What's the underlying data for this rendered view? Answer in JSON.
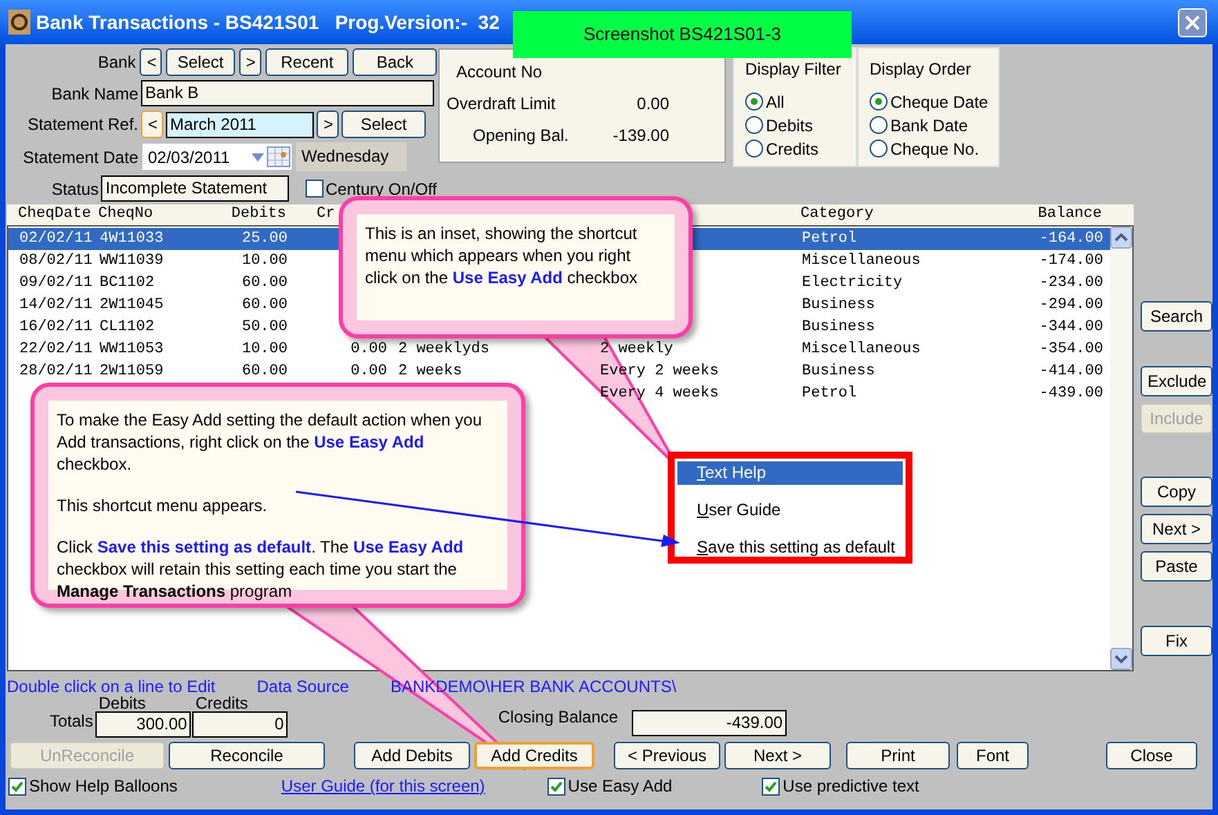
{
  "window": {
    "title": "Bank Transactions - BS421S01   Prog.Version:-  32"
  },
  "banner": {
    "text": "Screenshot BS421S01-3"
  },
  "bank": {
    "label": "Bank",
    "buttons": [
      "<",
      "Select",
      ">",
      "Recent",
      "Back"
    ]
  },
  "bank_name": {
    "label": "Bank Name",
    "value": "Bank B"
  },
  "statement_ref": {
    "label": "Statement Ref.",
    "prev": "<",
    "value": "March 2011",
    "next": ">",
    "select": "Select"
  },
  "statement_date": {
    "label": "Statement Date",
    "value": "02/03/2011",
    "day": "Wednesday"
  },
  "status": {
    "label": "Status",
    "value": "Incomplete Statement"
  },
  "century": {
    "label": "Century On/Off",
    "checked": false
  },
  "account": [
    {
      "label": "Account No"
    },
    {
      "label": "Overdraft Limit",
      "value": "0.00"
    },
    {
      "label": "Opening Bal.",
      "value": "-139.00"
    }
  ],
  "display_filter": {
    "title": "Display Filter",
    "options": [
      {
        "label": "All",
        "selected": true
      },
      {
        "label": "Debits",
        "selected": false
      },
      {
        "label": "Credits",
        "selected": false
      }
    ]
  },
  "display_order": {
    "title": "Display Order",
    "options": [
      {
        "label": "Cheque Date",
        "selected": true
      },
      {
        "label": "Bank Date",
        "selected": false
      },
      {
        "label": "Cheque No.",
        "selected": false
      }
    ]
  },
  "table": {
    "columns": {
      "cheq_date": "CheqDate",
      "cheq_no": "CheqNo",
      "debits": "Debits",
      "credits": "Cr",
      "category": "Category",
      "balance": "Balance"
    },
    "rows": [
      {
        "cheq_date": "02/02/11",
        "cheq_no": "4W11033",
        "debits": "25.00",
        "category": "Petrol",
        "balance": "-164.00",
        "selected": true
      },
      {
        "cheq_date": "08/02/11",
        "cheq_no": "WW11039",
        "debits": "10.00",
        "category": "Miscellaneous",
        "balance": "-174.00",
        "selected": false
      },
      {
        "cheq_date": "09/02/11",
        "cheq_no": "BC1102",
        "debits": "60.00",
        "category": "Electricity",
        "balance": "-234.00",
        "selected": false
      },
      {
        "cheq_date": "14/02/11",
        "cheq_no": "2W11045",
        "debits": "60.00",
        "category": "Business",
        "balance": "-294.00",
        "selected": false
      },
      {
        "cheq_date": "16/02/11",
        "cheq_no": "CL1102",
        "debits": "50.00",
        "category": "Business",
        "balance": "-344.00",
        "selected": false
      },
      {
        "cheq_date": "22/02/11",
        "cheq_no": "WW11053",
        "debits": "10.00",
        "credits": "0.00",
        "column_5": "2 weeklyds",
        "column_6": "2 weekly",
        "category": "Miscellaneous",
        "balance": "-354.00",
        "selected": false
      },
      {
        "cheq_date": "28/02/11",
        "cheq_no": "2W11059",
        "debits": "60.00",
        "credits": "0.00",
        "column_5": "2 weeks",
        "column_6": "Every 2 weeks",
        "category": "Business",
        "balance": "-414.00",
        "selected": false
      },
      {
        "column_6": "Every 4 weeks",
        "category": "Petrol",
        "balance": "-439.00",
        "selected": false
      }
    ]
  },
  "side_buttons": [
    {
      "label": "Search",
      "disabled": false
    },
    {
      "label": "Exclude",
      "disabled": false
    },
    {
      "label": "Include",
      "disabled": true
    },
    {
      "label": "Copy",
      "disabled": false
    },
    {
      "label": "Next >",
      "disabled": false
    },
    {
      "label": "Paste",
      "disabled": false
    },
    {
      "label": "Fix",
      "disabled": false
    }
  ],
  "hint": "Double click on a line to Edit",
  "data_source": {
    "label": "Data Source",
    "path": "BANKDEMO\\HER BANK ACCOUNTS\\"
  },
  "totals": {
    "label": "Totals",
    "debits_label": "Debits",
    "debits": "300.00",
    "credits_label": "Credits",
    "credits": "0",
    "closing_label": "Closing Balance",
    "closing": "-439.00"
  },
  "bottom_buttons": [
    {
      "label": "UnReconcile",
      "disabled": true,
      "focused": false
    },
    {
      "label": "Reconcile",
      "disabled": false,
      "focused": false
    },
    {
      "label": "Add Debits",
      "disabled": false,
      "focused": false
    },
    {
      "label": "Add Credits",
      "disabled": false,
      "focused": true
    },
    {
      "label": "< Previous",
      "disabled": false,
      "focused": false
    },
    {
      "label": "Next >",
      "disabled": false,
      "focused": false
    },
    {
      "label": "Print",
      "disabled": false,
      "focused": false
    },
    {
      "label": "Font",
      "disabled": false,
      "focused": false
    },
    {
      "label": "Close",
      "disabled": false,
      "focused": false
    }
  ],
  "options_bar": [
    {
      "kind": "checkbox",
      "label": "Show Help Balloons",
      "checked": true
    },
    {
      "kind": "link",
      "label": "User Guide (for this screen)"
    },
    {
      "kind": "checkbox",
      "label": "Use Easy Add",
      "checked": true
    },
    {
      "kind": "checkbox",
      "label": "Use predictive text",
      "checked": true
    }
  ],
  "callouts": [
    {
      "paragraphs": [
        [
          {
            "kind": "plain",
            "text": "This is an inset, showing the shortcut menu which appears when you right click on the "
          },
          {
            "kind": "highlight",
            "text": "Use Easy Add"
          },
          {
            "kind": "plain",
            "text": " checkbox"
          }
        ]
      ]
    },
    {
      "paragraphs": [
        [
          {
            "kind": "plain",
            "text": "To make the Easy Add setting the default action when you Add transactions, right click on the "
          },
          {
            "kind": "highlight",
            "text": "Use Easy Add"
          },
          {
            "kind": "plain",
            "text": " checkbox."
          }
        ],
        [
          {
            "kind": "plain",
            "text": "This shortcut menu appears."
          }
        ],
        [
          {
            "kind": "plain",
            "text": "Click "
          },
          {
            "kind": "highlight",
            "text": "Save this setting as default"
          },
          {
            "kind": "plain",
            "text": ". The "
          },
          {
            "kind": "highlight",
            "text": "Use Easy Add"
          },
          {
            "kind": "plain",
            "text": " checkbox will retain this setting each time you start the "
          },
          {
            "kind": "bold",
            "text": "Manage Transactions"
          },
          {
            "kind": "plain",
            "text": " program"
          }
        ]
      ]
    }
  ],
  "inset_menu": {
    "items": [
      {
        "label": "Text Help",
        "selected": true
      },
      {
        "label": "User Guide",
        "selected": false
      },
      {
        "label": "Save this setting as default",
        "selected": false
      }
    ]
  }
}
